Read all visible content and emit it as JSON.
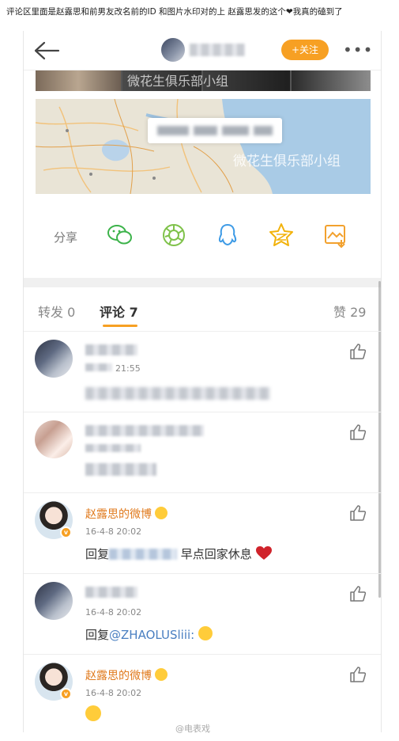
{
  "caption": "评论区里面是赵露思和前男友改名前的ID 和图片水印对的上 赵露思发的这个❤我真的磕到了",
  "header": {
    "follow_label": "+关注",
    "more_label": "•••"
  },
  "images": {
    "watermark": "微花生俱乐部小组",
    "map_watermark": "微花生俱乐部小组"
  },
  "share": {
    "label": "分享",
    "icons": [
      "wechat-icon",
      "moments-icon",
      "qq-icon",
      "qzone-icon",
      "save-image-icon"
    ]
  },
  "tabs": {
    "repost_label": "转发 0",
    "comment_label": "评论 7",
    "like_label": "赞 29"
  },
  "comments": [
    {
      "name": "",
      "time": "21:55",
      "body": ""
    },
    {
      "name": "",
      "time": "",
      "body": ""
    },
    {
      "name": "赵露思的微博",
      "time": "16-4-8 20:02",
      "body_prefix": "回复",
      "body_text": "早点回家休息"
    },
    {
      "name": "",
      "time": "16-4-8 20:02",
      "body_prefix": "回复",
      "body_mention": "@ZHAOLUSliii:"
    },
    {
      "name": "赵露思的微博",
      "time": "16-4-8 20:02",
      "body": ""
    }
  ],
  "footer_watermark": "@电表戏",
  "colors": {
    "accent": "#f7a023",
    "name": "#e07a1d",
    "mention": "#4a7fc1",
    "heart": "#d0232b"
  }
}
